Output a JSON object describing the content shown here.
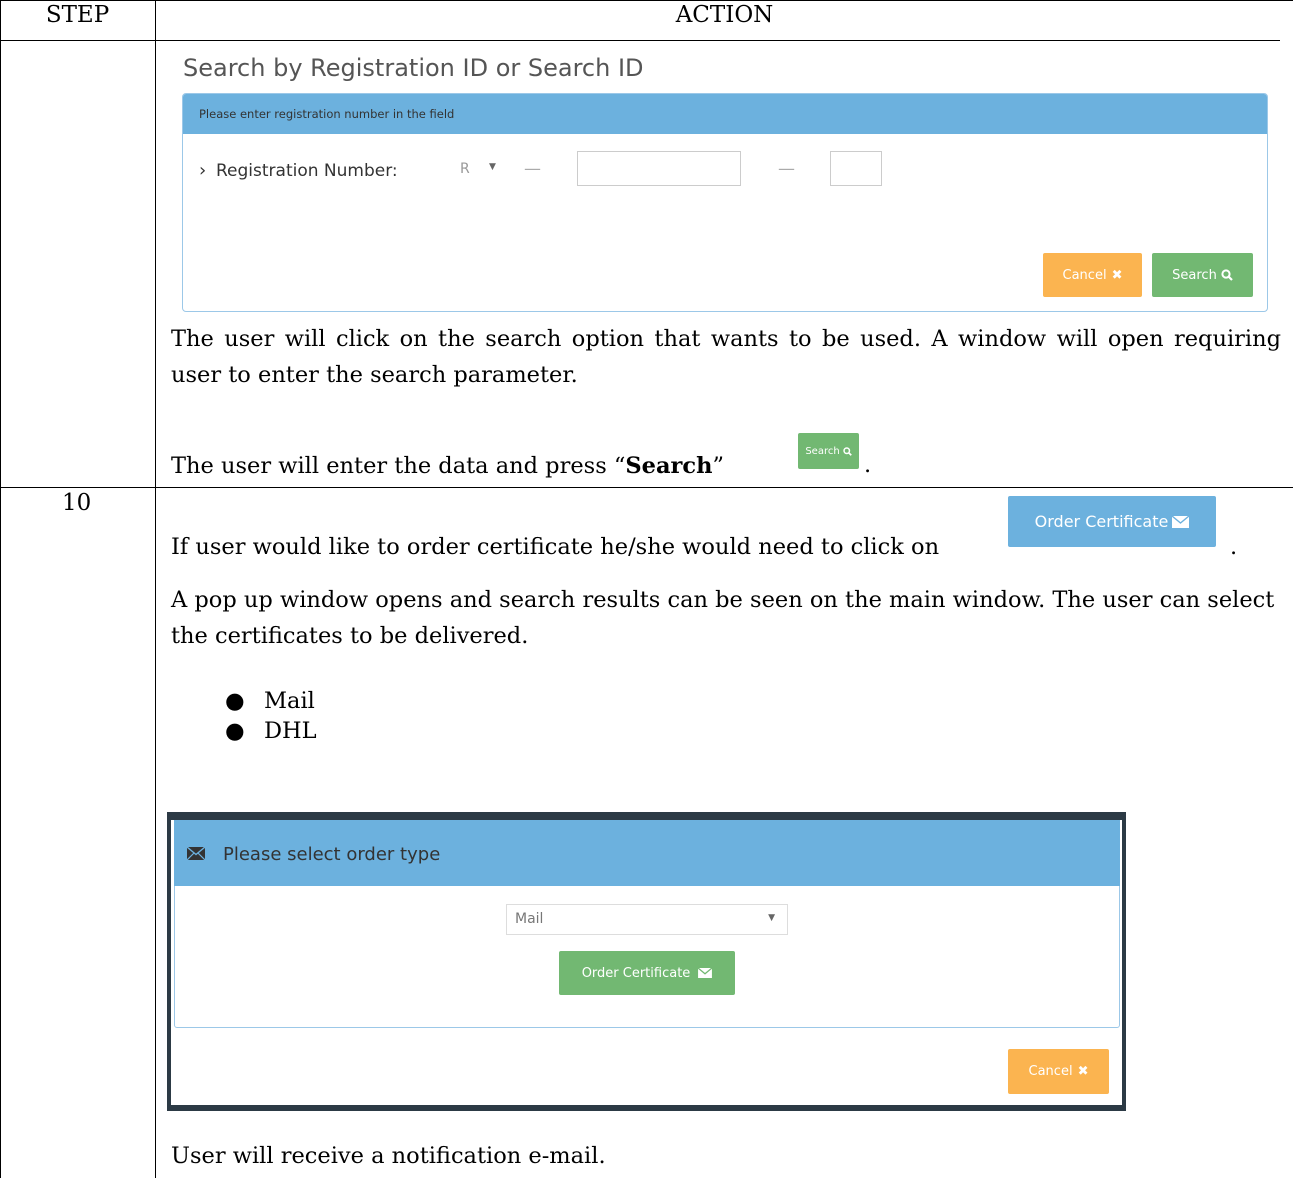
{
  "table": {
    "header_step": "STEP",
    "header_action": "ACTION",
    "row2_step": "10"
  },
  "search_panel": {
    "title": "Search by Registration ID or Search ID",
    "header_text": "Please enter registration number in the field",
    "reg_label": "Registration Number:",
    "prefix_value": "R",
    "dash": "—",
    "cancel_label": "Cancel",
    "search_label": "Search"
  },
  "text": {
    "p1": "The user will click on the search option that wants to be used. A window will open requiring user to enter the search parameter.",
    "p2_before": "The user will enter the data and press “",
    "p2_bold": "Search",
    "p2_after": "”",
    "p2_end": ".",
    "inline_search_label": "Search",
    "p3": "If user would like to order certificate he/she would need to click on",
    "p3_end": ".",
    "order_cert_label": "Order Certificate",
    "p4": "A pop up window opens and search results can be seen on the main window. The user can select the certificates to be delivered.",
    "bullets": [
      "Mail",
      "DHL"
    ],
    "p5": "User will receive a notification e-mail."
  },
  "modal": {
    "title": "Please select order type",
    "select_value": "Mail",
    "order_button": "Order Certificate",
    "cancel_button": "Cancel"
  },
  "colors": {
    "panel_blue": "#6cb1de",
    "button_orange": "#fbb450",
    "button_green": "#72b872"
  }
}
